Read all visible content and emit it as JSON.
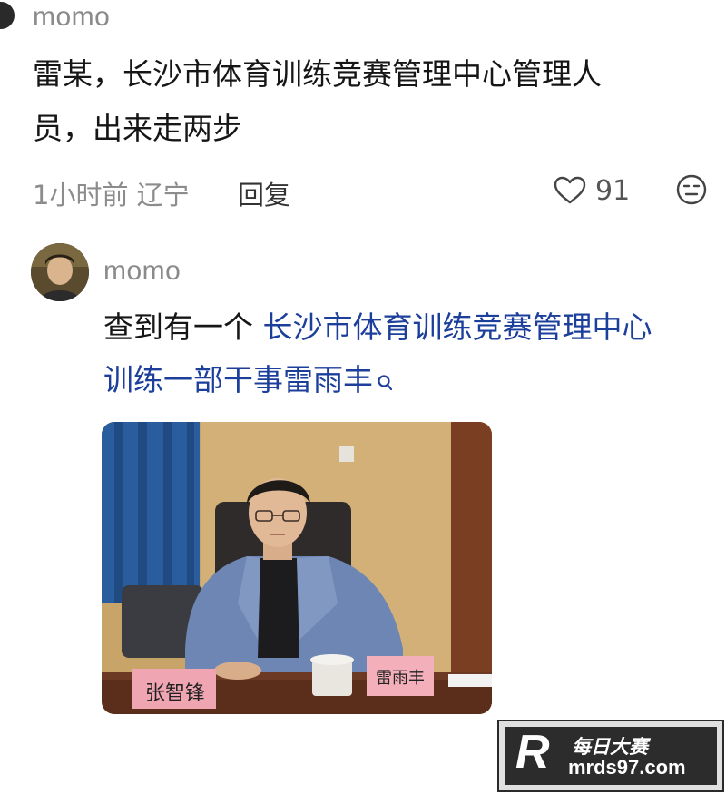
{
  "comment1": {
    "username": "momo",
    "text_line1": "雷某，长沙市体育训练竞赛管理中心管理人",
    "text_line2": "员，出来走两步",
    "time_location": "1小时前 辽宁",
    "reply_label": "回复",
    "like_count": "91",
    "icons": [
      "heart-icon",
      "emoji-icon"
    ]
  },
  "reply": {
    "username": "momo",
    "text_prefix": "查到有一个 ",
    "link_line1": "长沙市体育训练竞赛管理中心",
    "link_line2": "训练一部干事雷雨丰",
    "icons": [
      "search-icon"
    ],
    "photo": {
      "nameplate_left": "张智锋",
      "nameplate_right": "雷雨丰"
    }
  },
  "watermark": {
    "logo_letter": "R",
    "brand": "每日大赛",
    "url": "mrds97.com"
  },
  "colors": {
    "link": "#1c3f9c",
    "meta": "#8c8c8c",
    "username": "#8a8a8a"
  }
}
